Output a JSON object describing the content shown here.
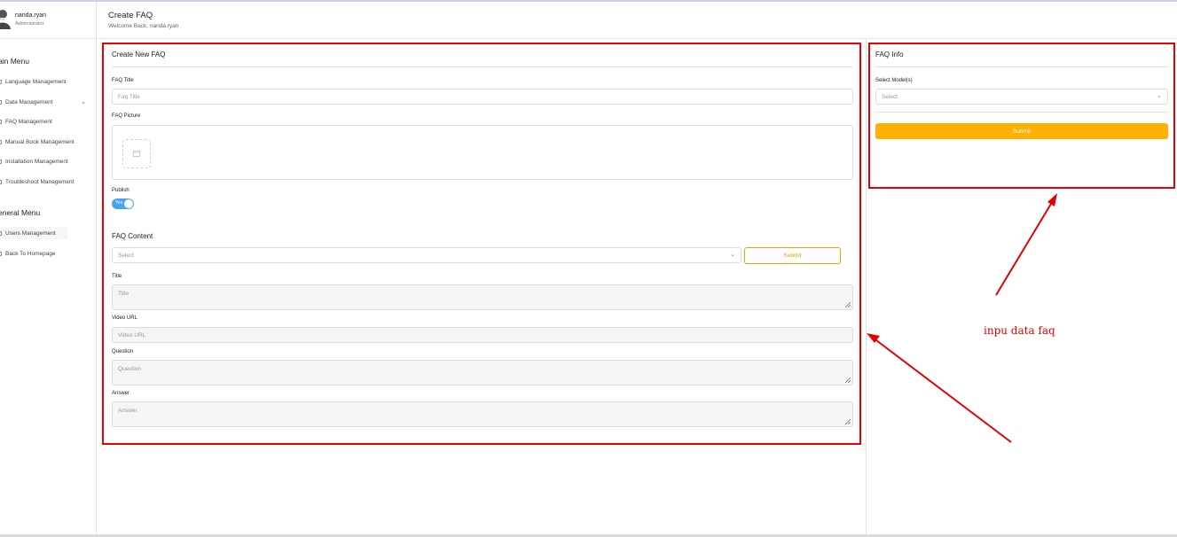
{
  "user": {
    "name": "nanda.ryan",
    "role": "Administrator"
  },
  "header": {
    "title": "Create FAQ",
    "subtitle": "Welcome Back, nanda.ryan"
  },
  "sidebar": {
    "main_menu_title": "ain Menu",
    "main_items": [
      {
        "label": "Language Management",
        "icon": "language-icon"
      },
      {
        "label": "Data Management",
        "icon": "data-icon",
        "has_chevron": true
      },
      {
        "label": "FAQ Management",
        "icon": "faq-icon"
      },
      {
        "label": "Manual Book Management",
        "icon": "book-icon"
      },
      {
        "label": "Installation Management",
        "icon": "install-icon"
      },
      {
        "label": "Troubleshoot Management",
        "icon": "wrench-icon"
      }
    ],
    "general_menu_title": "eneral Menu",
    "general_items": [
      {
        "label": "Users Management",
        "icon": "users-icon",
        "active": true
      },
      {
        "label": "Back To Homepage",
        "icon": "home-icon"
      }
    ]
  },
  "form": {
    "card_title": "Create New FAQ",
    "faq_title_label": "FAQ Title",
    "faq_title_placeholder": "Faq Title",
    "faq_picture_label": "FAQ Picture",
    "publish_label": "Publish",
    "publish_toggle_text": "Yes",
    "publish_value": true,
    "content_title": "FAQ Content",
    "content_select_placeholder": "Select",
    "content_submit": "Submit",
    "title_label": "Title",
    "title_placeholder": "Title",
    "video_label": "Video URL",
    "video_placeholder": "Video URL",
    "question_label": "Question",
    "question_placeholder": "Question",
    "answer_label": "Answer",
    "answer_placeholder": "Answer"
  },
  "info": {
    "card_title": "FAQ Info",
    "models_label": "Select Model(s)",
    "models_placeholder": "Select",
    "submit": "Submit"
  },
  "annotation": {
    "text": "inpu data faq",
    "color": "#e60000"
  },
  "colors": {
    "accent": "#ffb000",
    "toggle": "#4aa3f0",
    "highlight": "#e60000"
  }
}
